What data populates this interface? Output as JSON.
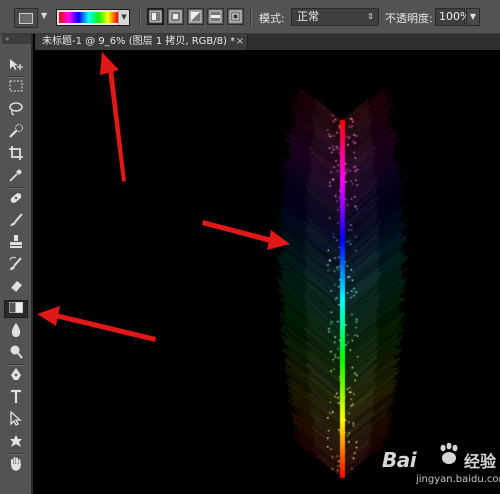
{
  "options_bar": {
    "tool_preset_icon": "gradient-tool-icon",
    "gradient_colors": [
      "#ff0000",
      "#ff00ff",
      "#0000ff",
      "#00ffff",
      "#00ff00",
      "#ffff00",
      "#ff0000"
    ],
    "gradient_types": [
      "linear",
      "radial",
      "angle",
      "reflected",
      "diamond"
    ],
    "selected_gradient_type": "linear",
    "mode_label": "模式:",
    "mode_value": "正常",
    "opacity_label": "不透明度:",
    "opacity_value": "100%"
  },
  "document_tab": {
    "title": "未标题-1 @ 9_6% (图层 1 拷贝, RGB/8) *",
    "close_glyph": "×"
  },
  "toolbox": {
    "collapse_glyph": "»",
    "selected_tool": "gradient-tool",
    "tools": [
      "move",
      "marquee",
      "lasso",
      "quick-selection",
      "crop",
      "eyedropper",
      "spot-healing-brush",
      "brush",
      "clone-stamp",
      "history-brush",
      "eraser",
      "gradient",
      "blur",
      "dodge",
      "pen",
      "type",
      "path-selection",
      "custom-shape",
      "hand"
    ]
  },
  "canvas": {
    "background": "#000000",
    "artwork": "rainbow-feather-gradient",
    "annotation_color": "#e01818"
  },
  "watermark": {
    "brand": "Bai",
    "brand_suffix": "经验",
    "url": "jingyan.baidu.com"
  }
}
